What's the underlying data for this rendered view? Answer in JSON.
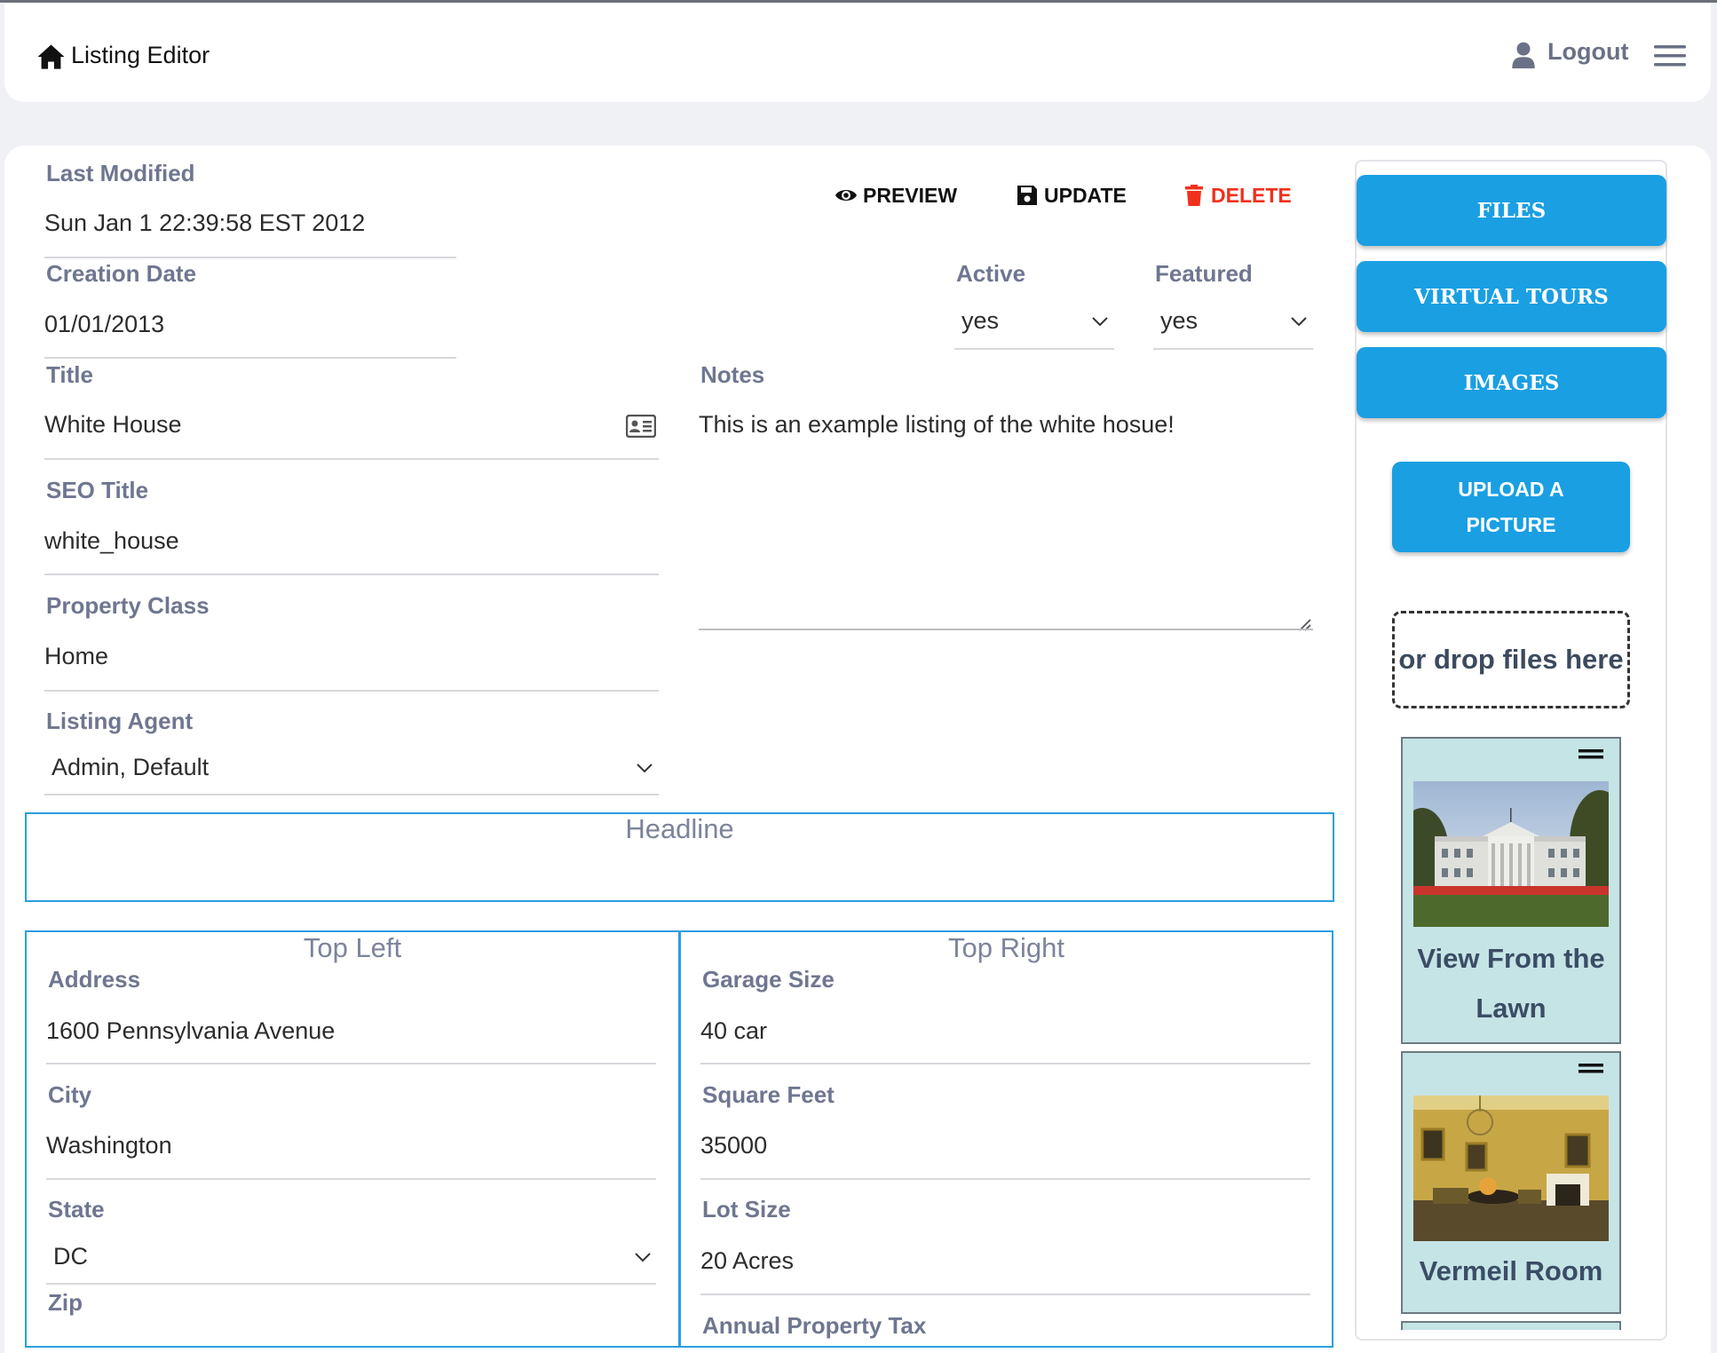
{
  "header": {
    "title": "Listing Editor",
    "logout_label": "Logout"
  },
  "fields": {
    "last_modified": {
      "label": "Last Modified",
      "value": "Sun Jan 1 22:39:58 EST 2012"
    },
    "creation_date": {
      "label": "Creation Date",
      "value": "01/01/2013"
    },
    "title": {
      "label": "Title",
      "value": "White House"
    },
    "seo_title": {
      "label": "SEO Title",
      "value": "white_house"
    },
    "property_class": {
      "label": "Property Class",
      "value": "Home"
    },
    "listing_agent": {
      "label": "Listing Agent",
      "value": "Admin, Default"
    },
    "active": {
      "label": "Active",
      "value": "yes"
    },
    "featured": {
      "label": "Featured",
      "value": "yes"
    },
    "notes": {
      "label": "Notes",
      "value": "This is an example listing of the white hosue!"
    }
  },
  "actions": {
    "preview": "PREVIEW",
    "update": "UPDATE",
    "delete": "DELETE"
  },
  "sections": {
    "headline": "Headline",
    "top_left": {
      "title": "Top Left",
      "address": {
        "label": "Address",
        "value": "1600 Pennsylvania Avenue"
      },
      "city": {
        "label": "City",
        "value": "Washington"
      },
      "state": {
        "label": "State",
        "value": "DC"
      },
      "zip": {
        "label": "Zip"
      }
    },
    "top_right": {
      "title": "Top Right",
      "garage_size": {
        "label": "Garage Size",
        "value": "40 car"
      },
      "square_feet": {
        "label": "Square Feet",
        "value": "35000"
      },
      "lot_size": {
        "label": "Lot Size",
        "value": "20 Acres"
      },
      "annual_tax": {
        "label": "Annual Property Tax"
      }
    }
  },
  "sidebar": {
    "files": "FILES",
    "virtual_tours": "VIRTUAL TOURS",
    "images": "IMAGES",
    "upload_line1": "UPLOAD A",
    "upload_line2": "PICTURE",
    "drop_zone": "or drop files here",
    "images_list": [
      {
        "caption_line1": "View From the",
        "caption_line2": "Lawn"
      },
      {
        "caption_line1": "Vermeil Room"
      }
    ]
  },
  "colors": {
    "accent": "#1a9fe3",
    "label": "#6f7690",
    "delete": "#f0301c",
    "thumb_bg": "#c5e4e6"
  }
}
